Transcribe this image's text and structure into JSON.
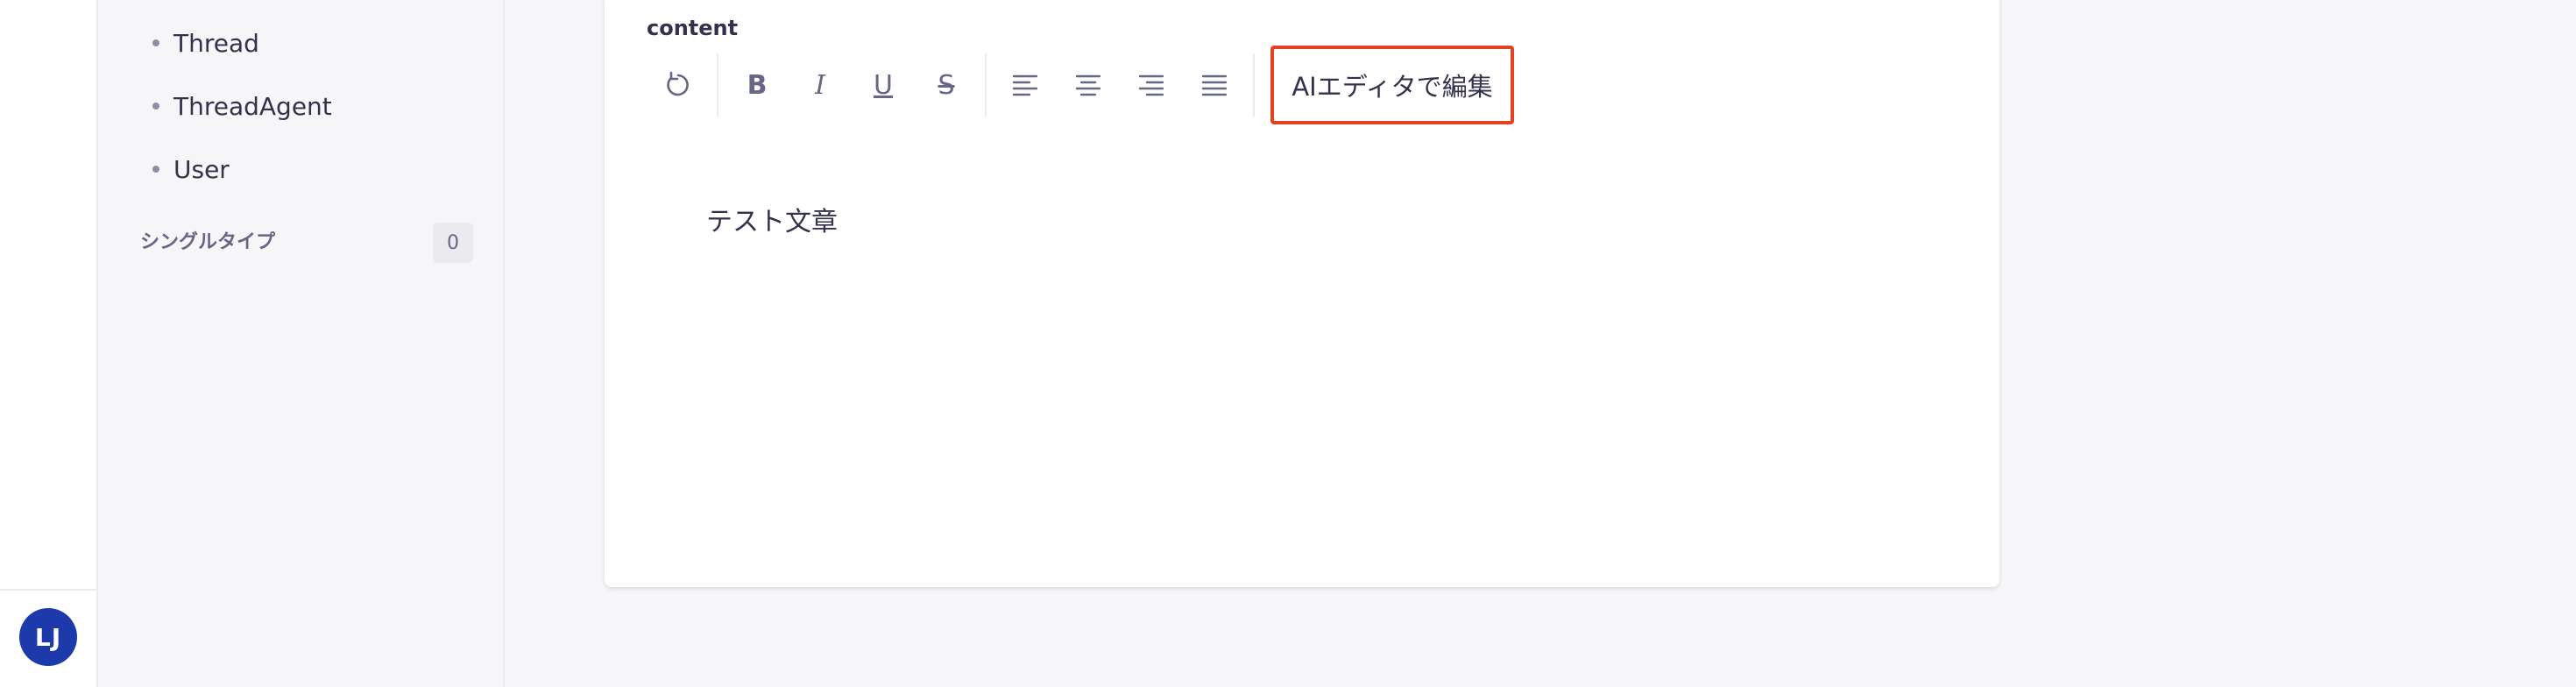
{
  "sidebar": {
    "items": [
      {
        "label": "Thread"
      },
      {
        "label": "ThreadAgent"
      },
      {
        "label": "User"
      }
    ],
    "single_types": {
      "label": "シングルタイプ",
      "count": "0"
    }
  },
  "user": {
    "initials": "LJ",
    "avatar_color": "#1c3aa9"
  },
  "editor": {
    "field_label": "content",
    "toolbar": {
      "undo_icon": "undo-icon",
      "bold_label": "B",
      "italic_label": "I",
      "underline_label": "U",
      "strike_label": "S",
      "ai_edit_label": "AIエディタで編集"
    },
    "content_text": "テスト文章",
    "highlight_color": "#e2421f"
  }
}
